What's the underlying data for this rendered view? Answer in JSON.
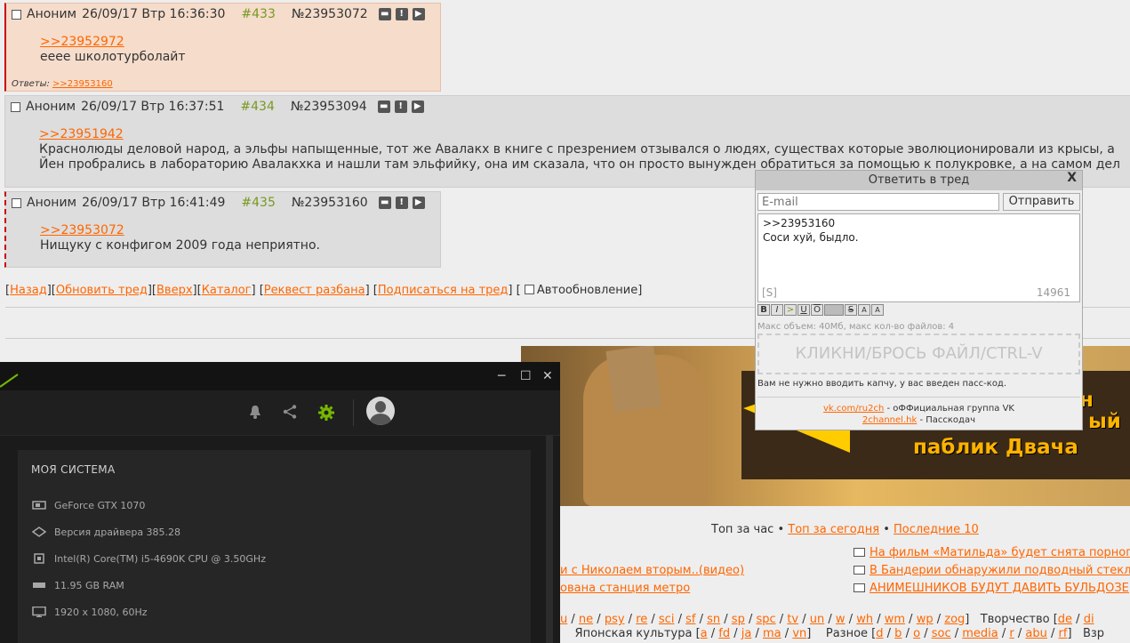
{
  "posts": [
    {
      "name": "Аноним",
      "date": "26/09/17 Втр 16:36:30",
      "num": "#433",
      "id": "№23953072",
      "reply_link": ">>23952972",
      "lines": [
        "ееее школотурболайт"
      ],
      "answers_label": "Ответы:",
      "answers": ">>23953160"
    },
    {
      "name": "Аноним",
      "date": "26/09/17 Втр 16:37:51",
      "num": "#434",
      "id": "№23953094",
      "reply_link": ">>23951942",
      "lines": [
        "Краснолюды деловой народ, а эльфы напыщенные, тот же Авалакх в книге с презрением отзывался о людях, существах которые эволюционировали из крысы, а",
        "Йен пробрались в лабораторию Авалакхка и нашли там эльфийку, она им сказала, что он просто вынужден обратиться за помощью к полукровке, а на самом дел"
      ]
    },
    {
      "name": "Аноним",
      "date": "26/09/17 Втр 16:41:49",
      "num": "#435",
      "id": "№23953160",
      "reply_link": ">>23953072",
      "lines": [
        "Нищуку с конфигом 2009 года неприятно."
      ]
    }
  ],
  "post_buttons": [
    "▬",
    "!",
    "▶"
  ],
  "nav": {
    "back": "Назад",
    "refresh": "Обновить тред",
    "up": "Вверх",
    "catalog": "Каталог",
    "request_ban": "Реквест разбана",
    "subscribe": "Подписаться на тред",
    "autorefresh": "Автообновление"
  },
  "banner": {
    "line1": "ый",
    "line2": "паблик Двача",
    "partial_top": "н"
  },
  "top": {
    "hour": "Топ за час",
    "today": "Топ за сегодня",
    "last10": "Последние 10",
    "left_links": [
      "и с Николаем вторым..(видео)",
      "ована станция метро"
    ],
    "right_links": [
      "На фильм «Матильда» будет снята порнопа",
      "В Бандерии обнаружили подводный стекло",
      "АНИМЕШНИКОВ БУДУТ ДАВИТЬ БУЛЬДОЗЕ"
    ]
  },
  "boards": {
    "row1_links": [
      "u",
      "ne",
      "psy",
      "re",
      "sci",
      "sf",
      "sn",
      "sp",
      "spc",
      "tv",
      "un",
      "w",
      "wh",
      "wm",
      "wp",
      "zog"
    ],
    "row1_cat": "Творчество",
    "row1_cat_links": [
      "de",
      "di"
    ],
    "row2_cat_a": "Японская культура",
    "row2_links_a": [
      "a",
      "fd",
      "ja",
      "ma",
      "vn"
    ],
    "row2_cat_b": "Разное",
    "row2_links_b": [
      "d",
      "b",
      "o",
      "soc",
      "media",
      "r",
      "abu",
      "rf"
    ],
    "row2_tail": "Взр"
  },
  "gfe": {
    "panel_title": "МОЯ СИСТЕМА",
    "specs": [
      {
        "icon": "gpu-icon",
        "text": "GeForce GTX 1070"
      },
      {
        "icon": "driver-icon",
        "text": "Версия драйвера 385.28"
      },
      {
        "icon": "cpu-icon",
        "text": "Intel(R) Core(TM) i5-4690K CPU @ 3.50GHz"
      },
      {
        "icon": "ram-icon",
        "text": "11.95 GB RAM"
      },
      {
        "icon": "monitor-icon",
        "text": "1920 x 1080, 60Hz"
      }
    ],
    "accent": "#76b900"
  },
  "form": {
    "title": "Ответить в тред",
    "close": "X",
    "email_placeholder": "E-mail",
    "send": "Отправить",
    "text_lines": [
      ">>23953160",
      "Соси хуй, быдло."
    ],
    "sage": "[S]",
    "counter": "14961",
    "markup": [
      "B",
      "I",
      ">",
      "U",
      "O",
      "",
      "S",
      "A",
      "A"
    ],
    "limits": "Макс объем: 40Мб, макс кол-во файлов: 4",
    "drop": "КЛИКНИ/БРОСЬ ФАЙЛ/CTRL-V",
    "passcode_note": "Вам не нужно вводить капчу, у вас введен пасс-код.",
    "vk_link": "vk.com/ru2ch",
    "vk_text": " - оФФициальная группа VK",
    "pass_link": "2channel.hk",
    "pass_text": " - Пасскодач"
  }
}
